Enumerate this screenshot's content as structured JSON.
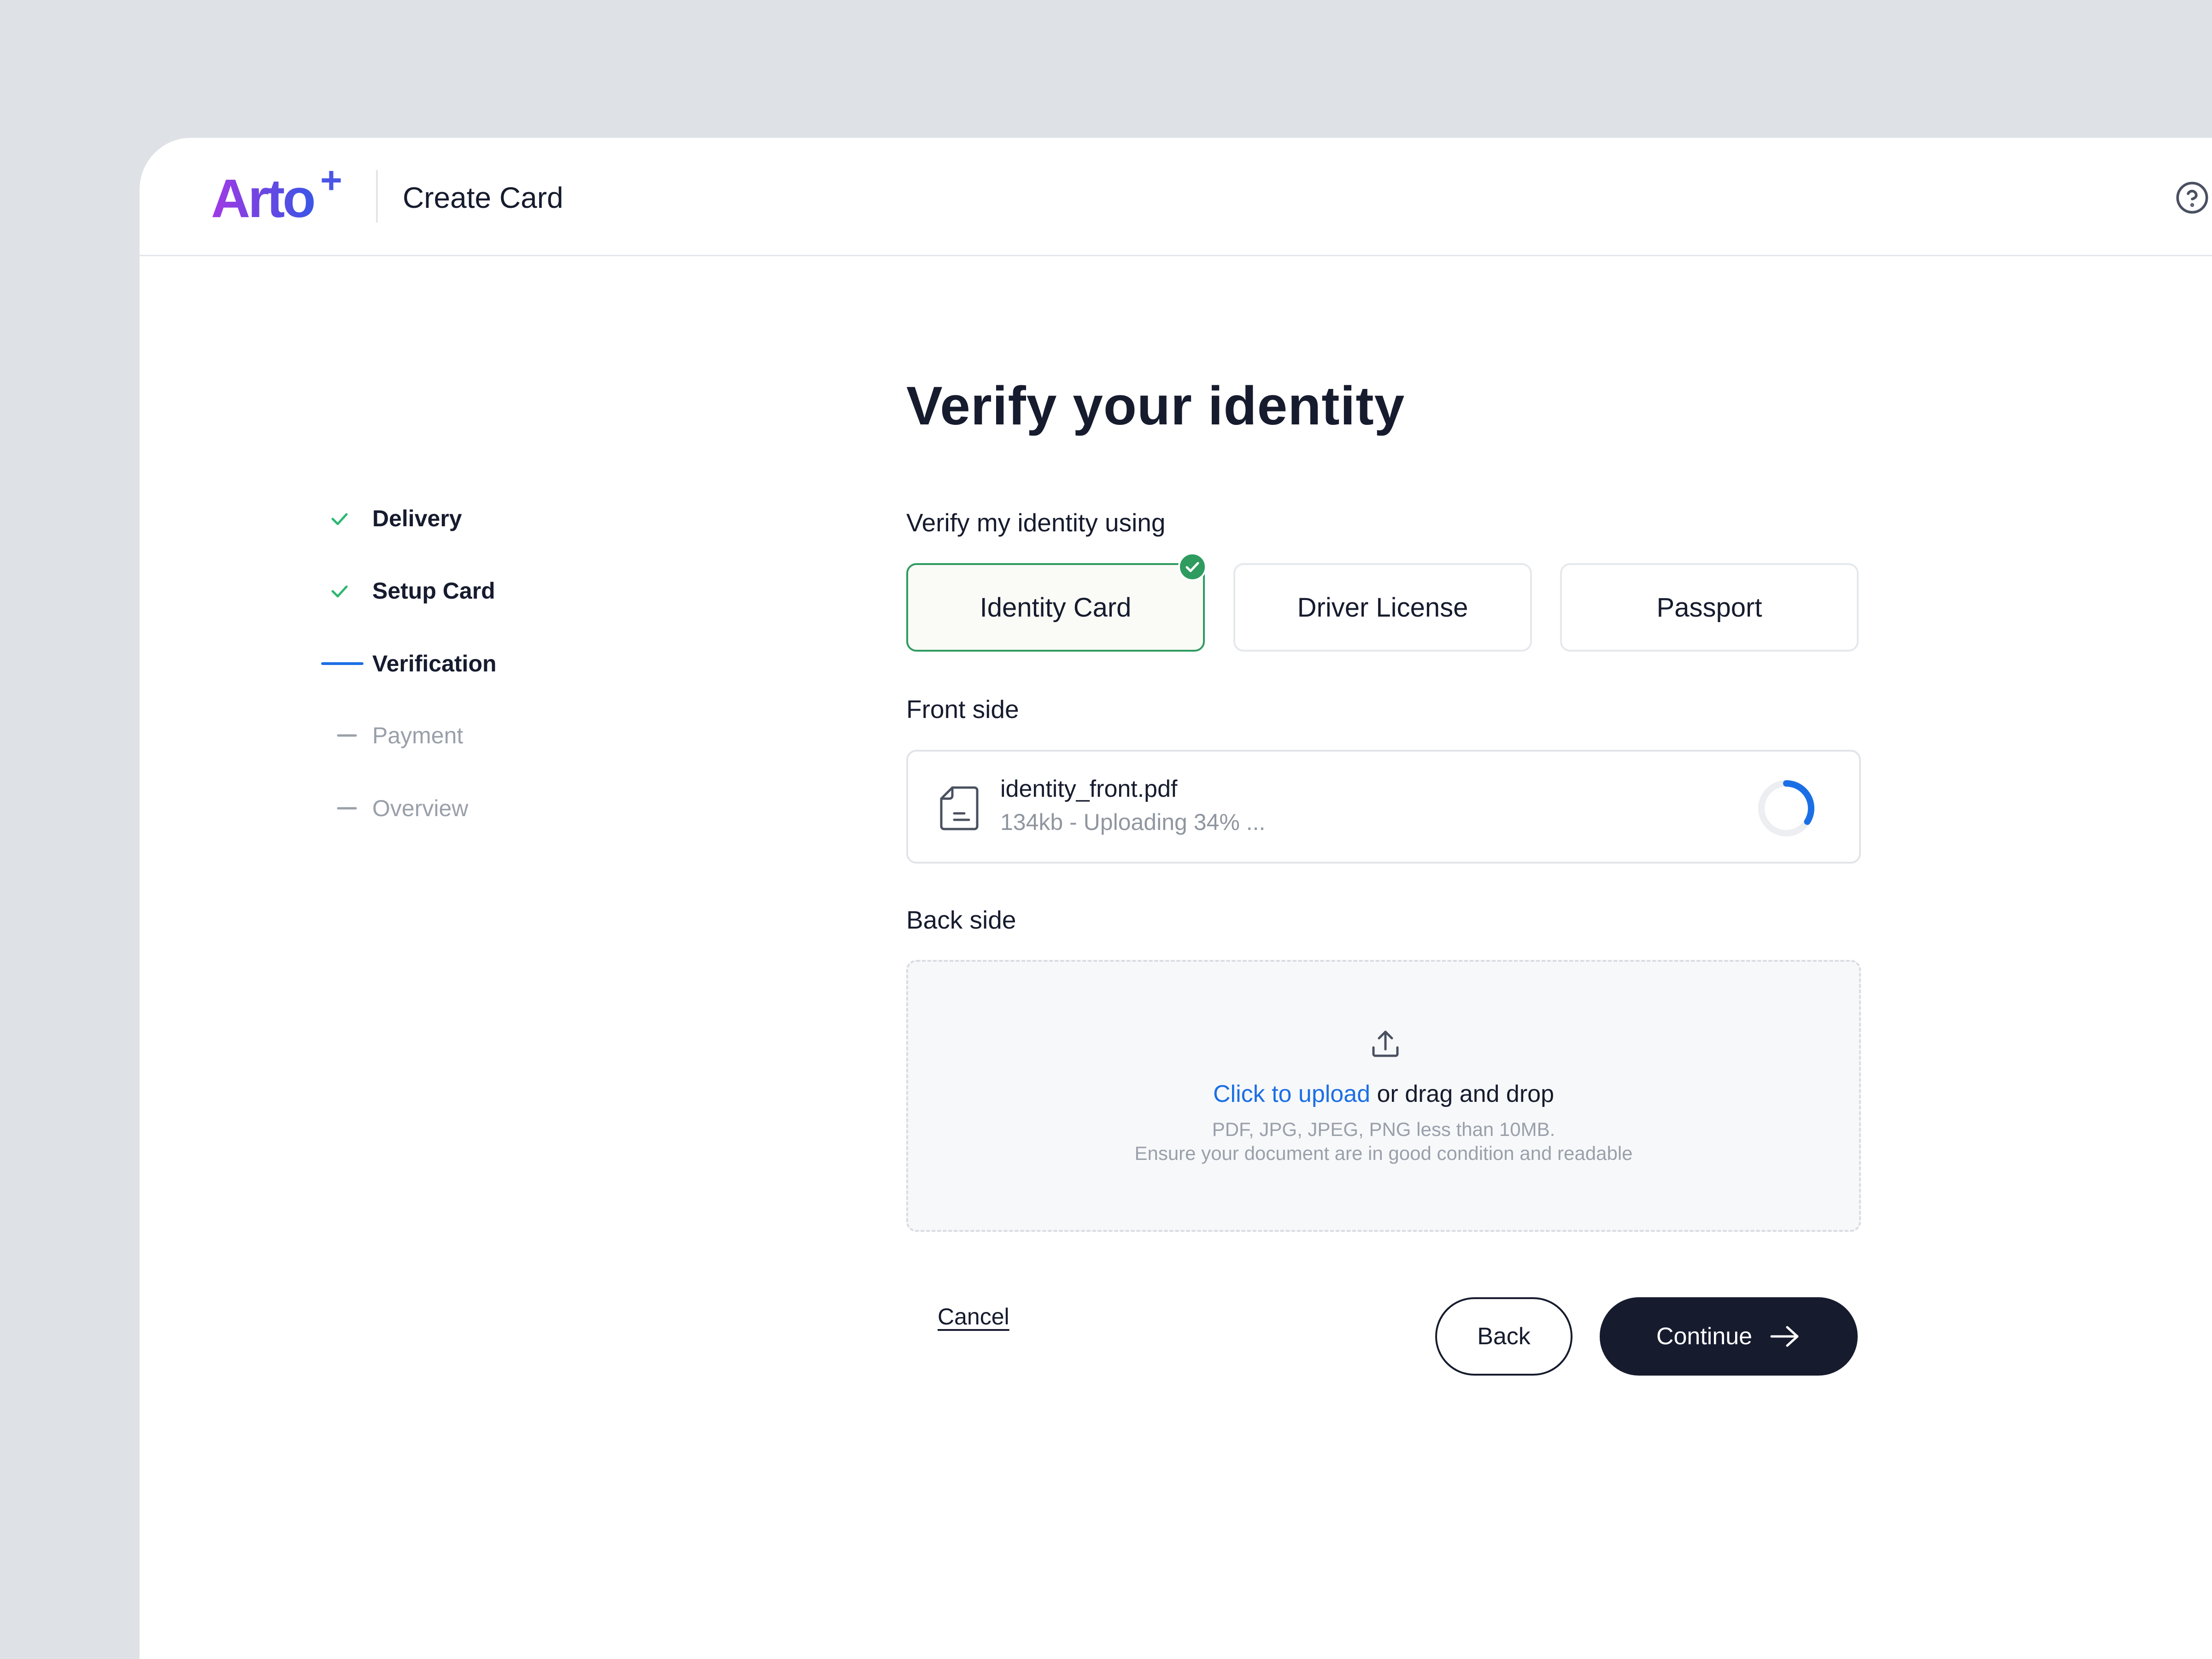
{
  "header": {
    "logo_text": "Arto",
    "logo_superscript": "+",
    "title": "Create Card",
    "help_icon": "help-circle-icon"
  },
  "stepper": {
    "steps": [
      {
        "label": "Delivery",
        "state": "completed"
      },
      {
        "label": "Setup Card",
        "state": "completed"
      },
      {
        "label": "Verification",
        "state": "current"
      },
      {
        "label": "Payment",
        "state": "upcoming"
      },
      {
        "label": "Overview",
        "state": "upcoming"
      }
    ]
  },
  "main": {
    "title": "Verify your identity",
    "method_label": "Verify my identity using",
    "options": [
      {
        "label": "Identity Card",
        "selected": true
      },
      {
        "label": "Driver License",
        "selected": false
      },
      {
        "label": "Passport",
        "selected": false
      }
    ],
    "front": {
      "label": "Front side",
      "file_name": "identity_front.pdf",
      "status": "134kb - Uploading 34% ...",
      "progress_percent": 34
    },
    "back": {
      "label": "Back side",
      "upload_link": "Click to upload",
      "upload_rest": " or drag and drop",
      "hint_formats": "PDF, JPG, JPEG, PNG less than 10MB.",
      "hint_condition": "Ensure your document are in good condition and readable"
    }
  },
  "actions": {
    "cancel": "Cancel",
    "back": "Back",
    "continue": "Continue"
  },
  "colors": {
    "accent_blue": "#1B6FE5",
    "success_green": "#2E9B5F",
    "dark": "#161B2E",
    "muted": "#9AA0AA"
  }
}
